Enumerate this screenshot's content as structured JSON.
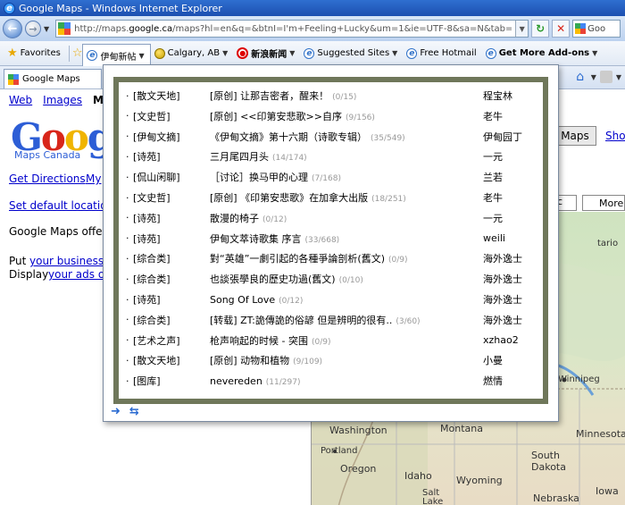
{
  "window": {
    "title": "Google Maps - Windows Internet Explorer"
  },
  "address_bar": {
    "url_prefix": "http://maps.",
    "url_domain": "google.ca",
    "url_suffix": "/maps?hl=en&q=&btnI=I'm+Feeling+Lucky&um=1&ie=UTF-8&sa=N&tab=wl",
    "search_placeholder": "Goo"
  },
  "favorites_bar": {
    "favorites_label": "Favorites",
    "items": [
      {
        "label": "伊甸新帖",
        "icon": "ie-icon"
      },
      {
        "label": "Calgary, AB",
        "icon": "globe-icon"
      },
      {
        "label": "新浪新闻",
        "icon": "sina-icon"
      },
      {
        "label": "Suggested Sites",
        "icon": "ie-icon"
      },
      {
        "label": "Free Hotmail",
        "icon": "ie-icon"
      },
      {
        "label": "Get More Add-ons",
        "icon": "ie-icon"
      }
    ]
  },
  "tab": {
    "label": "Google Maps"
  },
  "page": {
    "links": [
      "Web",
      "Images",
      "Ma"
    ],
    "logo_sub": "Maps Canada",
    "get_directions": "Get Directions",
    "my": "My",
    "set_default": "Set default location",
    "offered": "Google Maps offere",
    "put_your": "Put",
    "your_business": "your business o",
    "display": "Display",
    "your_ads": "your ads on",
    "maps_button": "Maps",
    "show": "Show",
    "more_button": "More",
    "small_button": "c"
  },
  "map": {
    "labels": [
      {
        "text": "Winnipeg"
      },
      {
        "text": "Washington"
      },
      {
        "text": "Montana"
      },
      {
        "text": "Minnesota"
      },
      {
        "text": "Portland"
      },
      {
        "text": "Oregon"
      },
      {
        "text": "South Dakota"
      },
      {
        "text": "Idaho"
      },
      {
        "text": "Wyoming"
      },
      {
        "text": "Salt Lake City"
      },
      {
        "text": "Nebraska"
      },
      {
        "text": "Iowa"
      },
      {
        "text": "tario"
      }
    ]
  },
  "popup": {
    "rows": [
      {
        "cat": "[散文天地]",
        "title": "[原创] 让那吉密者，醒来！",
        "count": "(0/15)",
        "author": "程宝林"
      },
      {
        "cat": "[文史哲]",
        "title": "[原创] <<印第安悲歌>>自序",
        "count": "(9/156)",
        "author": "老牛"
      },
      {
        "cat": "[伊甸文摘]",
        "title": "《伊甸文摘》第十六期（诗歌专辑）",
        "count": "(35/549)",
        "author": "伊甸园丁"
      },
      {
        "cat": "[诗苑]",
        "title": "三月尾四月头",
        "count": "(14/174)",
        "author": "一元"
      },
      {
        "cat": "[侃山闲聊]",
        "title": "［讨论］换马甲的心理",
        "count": "(7/168)",
        "author": "兰若"
      },
      {
        "cat": "[文史哲]",
        "title": "[原创] 《印第安悲歌》在加拿大出版",
        "count": "(18/251)",
        "author": "老牛"
      },
      {
        "cat": "[诗苑]",
        "title": "散漫的椅子",
        "count": "(0/12)",
        "author": "一元"
      },
      {
        "cat": "[诗苑]",
        "title": "伊甸文萃诗歌集 序言",
        "count": "(33/668)",
        "author": "weili"
      },
      {
        "cat": "[综合类]",
        "title": "對“英雄”一劇引起的各種爭論剖析(舊文)",
        "count": "(0/9)",
        "author": "海外逸士"
      },
      {
        "cat": "[综合类]",
        "title": "也談張學良的歷史功過(舊文)",
        "count": "(0/10)",
        "author": "海外逸士"
      },
      {
        "cat": "[诗苑]",
        "title": "Song Of Love",
        "count": "(0/12)",
        "author": "海外逸士"
      },
      {
        "cat": "[综合类]",
        "title": "[转载] ZT:詭傳詭的俗諺 但是辨明的很有..",
        "count": "(3/60)",
        "author": "海外逸士"
      },
      {
        "cat": "[艺术之声]",
        "title": "枪声响起的时候 - 突围",
        "count": "(0/9)",
        "author": "xzhao2"
      },
      {
        "cat": "[散文天地]",
        "title": "[原创] 动物和植物",
        "count": "(9/109)",
        "author": "小曼"
      },
      {
        "cat": "[图库]",
        "title": "nevereden",
        "count": "(11/297)",
        "author": "燃情"
      }
    ]
  }
}
